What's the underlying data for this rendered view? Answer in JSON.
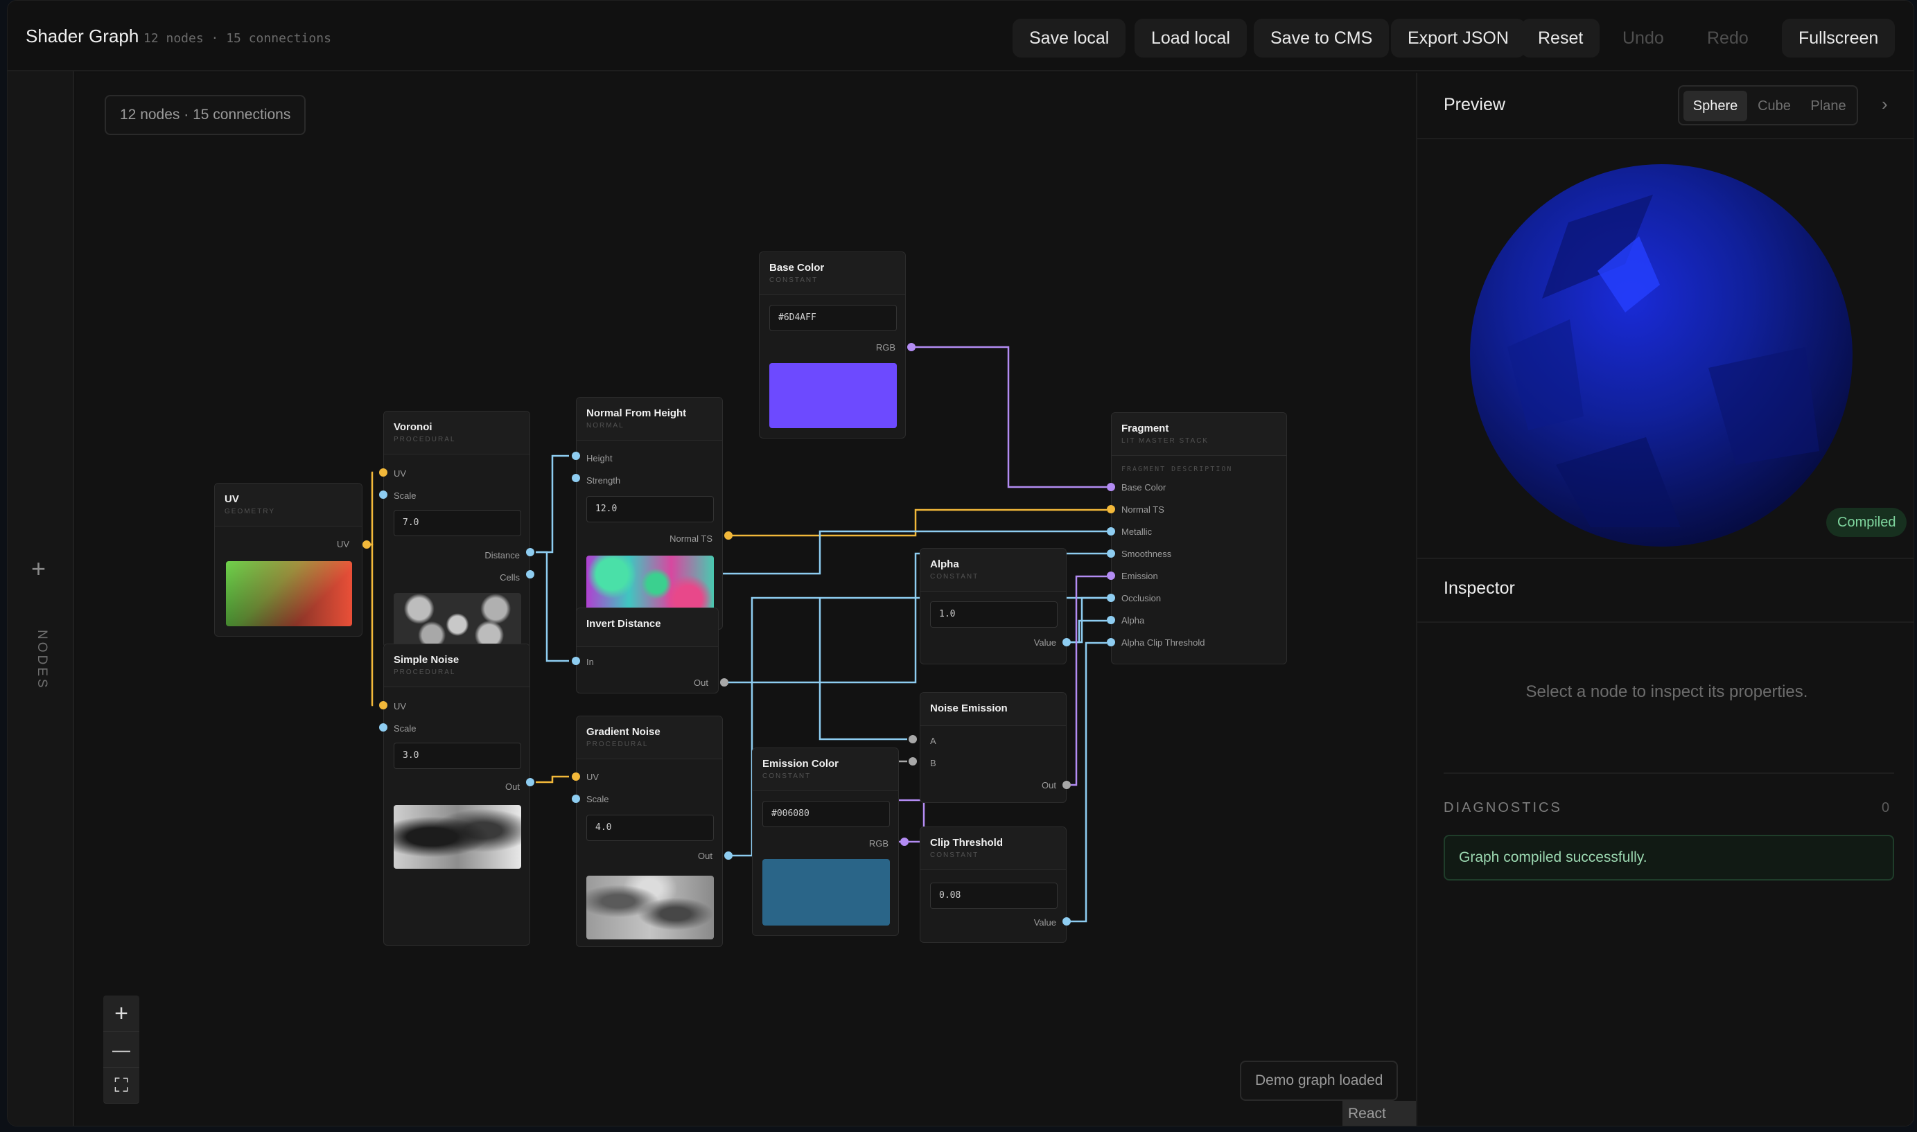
{
  "app": {
    "title": "Shader Graph",
    "subtitle": "12 nodes · 15 connections"
  },
  "toolbar": {
    "save_local": "Save local",
    "load_local": "Load local",
    "save_cms": "Save to CMS",
    "export_json": "Export JSON",
    "reset": "Reset",
    "undo": "Undo",
    "redo": "Redo",
    "fullscreen": "Fullscreen"
  },
  "left_rail": {
    "add_icon": "+",
    "label": "NODES"
  },
  "canvas": {
    "counts": "12 nodes · 15 connections",
    "status": "Demo graph loaded",
    "attribution": "React Flow",
    "zoom_in": "+",
    "zoom_out": "—",
    "fit": "⛶"
  },
  "nodes": {
    "uv": {
      "title": "UV",
      "type": "GEOMETRY",
      "out": "UV"
    },
    "voronoi": {
      "title": "Voronoi",
      "type": "PROCEDURAL",
      "in_uv": "UV",
      "in_scale": "Scale",
      "scale_value": "7.0",
      "out_distance": "Distance",
      "out_cells": "Cells"
    },
    "simple_noise": {
      "title": "Simple Noise",
      "type": "PROCEDURAL",
      "in_uv": "UV",
      "in_scale": "Scale",
      "scale_value": "3.0",
      "out": "Out"
    },
    "normal_from_height": {
      "title": "Normal From Height",
      "type": "NORMAL",
      "in_height": "Height",
      "in_strength": "Strength",
      "strength_value": "12.0",
      "out": "Normal TS"
    },
    "invert_distance": {
      "title": "Invert Distance",
      "in": "In",
      "out": "Out"
    },
    "gradient_noise": {
      "title": "Gradient Noise",
      "type": "PROCEDURAL",
      "in_uv": "UV",
      "in_scale": "Scale",
      "scale_value": "4.0",
      "out": "Out"
    },
    "base_color": {
      "title": "Base Color",
      "type": "CONSTANT",
      "value": "#6D4AFF",
      "out": "RGB",
      "swatch_color": "#6d4aff"
    },
    "emission_color": {
      "title": "Emission Color",
      "type": "CONSTANT",
      "value": "#006080",
      "out": "RGB",
      "swatch_color": "#2a6588"
    },
    "alpha": {
      "title": "Alpha",
      "type": "CONSTANT",
      "value": "1.0",
      "out": "Value"
    },
    "noise_emission": {
      "title": "Noise Emission",
      "in_a": "A",
      "in_b": "B",
      "out": "Out"
    },
    "clip_threshold": {
      "title": "Clip Threshold",
      "type": "CONSTANT",
      "value": "0.08",
      "out": "Value"
    },
    "fragment": {
      "title": "Fragment",
      "type": "LIT MASTER STACK",
      "section": "FRAGMENT DESCRIPTION",
      "inputs": [
        "Base Color",
        "Normal TS",
        "Metallic",
        "Smoothness",
        "Emission",
        "Occlusion",
        "Alpha",
        "Alpha Clip Threshold"
      ]
    }
  },
  "preview": {
    "title": "Preview",
    "tabs": [
      "Sphere",
      "Cube",
      "Plane"
    ],
    "active_tab": "Sphere",
    "collapse_icon": "›",
    "compiled": "Compiled"
  },
  "inspector": {
    "title": "Inspector",
    "empty": "Select a node to inspect its properties."
  },
  "diagnostics": {
    "label": "DIAGNOSTICS",
    "count": "0",
    "message": "Graph compiled successfully."
  },
  "colors": {
    "edge_float": "#8ecdf1",
    "edge_vector2": "#f2b83a",
    "edge_color": "#b38cf3",
    "edge_generic": "#a8a8a8",
    "success": "#7fd79f"
  }
}
